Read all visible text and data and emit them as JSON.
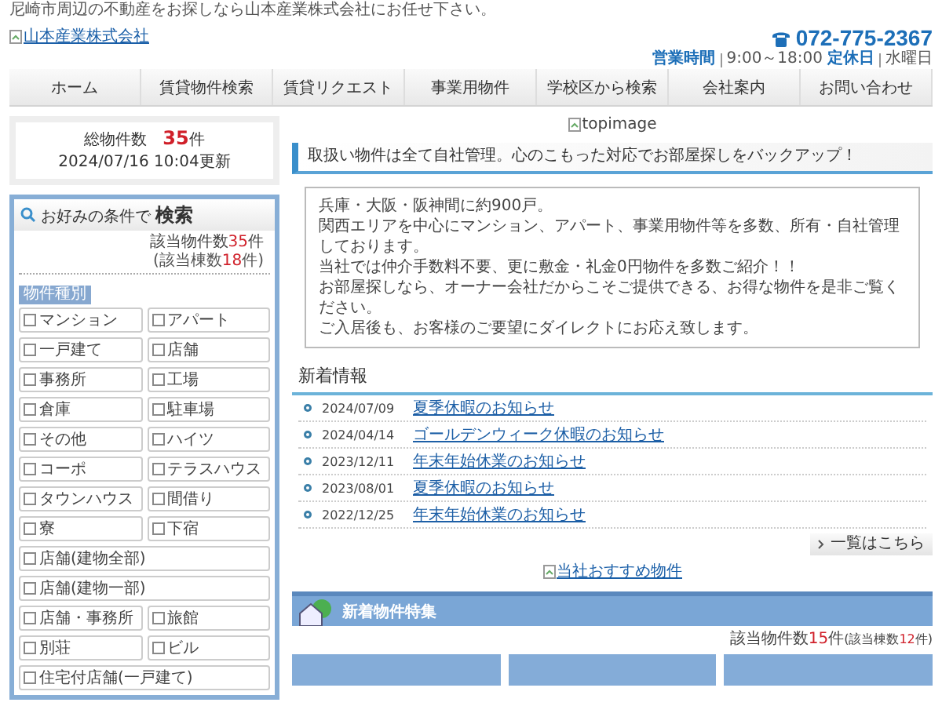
{
  "tagline": "尼崎市周辺の不動産をお探しなら山本産業株式会社にお任せ下さい。",
  "logo": {
    "alt": "山本産業株式会社"
  },
  "phone": {
    "number": "072-775-2367",
    "hours_label": "営業時間",
    "hours": "9:00～18:00",
    "closed_label": "定休日",
    "closed": "水曜日"
  },
  "nav": [
    {
      "label": "ホーム"
    },
    {
      "label": "賃貸物件検索"
    },
    {
      "label": "賃貸リクエスト"
    },
    {
      "label": "事業用物件"
    },
    {
      "label": "学校区から検索"
    },
    {
      "label": "会社案内"
    },
    {
      "label": "お問い合わせ"
    }
  ],
  "summary": {
    "label": "総物件数",
    "count": "35",
    "unit": "件",
    "updated": "2024/07/16 10:04更新"
  },
  "search": {
    "title_prefix": "お好みの条件で",
    "title": "検索",
    "hit_label": "該当物件数",
    "hit_count": "35",
    "hit_unit": "件",
    "sub_prefix": "(該当棟数",
    "sub_count": "18",
    "sub_suffix": "件)",
    "category_label": "物件種別",
    "options": [
      {
        "label": "マンション",
        "kind": "half",
        "checked": false
      },
      {
        "label": "アパート",
        "kind": "half",
        "checked": false
      },
      {
        "label": "一戸建て",
        "kind": "half",
        "checked": false
      },
      {
        "label": "店舗",
        "kind": "half",
        "checked": false
      },
      {
        "label": "事務所",
        "kind": "half",
        "checked": false
      },
      {
        "label": "工場",
        "kind": "half",
        "checked": false
      },
      {
        "label": "倉庫",
        "kind": "half",
        "checked": false
      },
      {
        "label": "駐車場",
        "kind": "half",
        "checked": false
      },
      {
        "label": "その他",
        "kind": "half",
        "checked": false
      },
      {
        "label": "ハイツ",
        "kind": "half",
        "checked": false
      },
      {
        "label": "コーポ",
        "kind": "half",
        "checked": false
      },
      {
        "label": "テラスハウス",
        "kind": "half",
        "checked": false
      },
      {
        "label": "タウンハウス",
        "kind": "half",
        "checked": false
      },
      {
        "label": "間借り",
        "kind": "half",
        "checked": false
      },
      {
        "label": "寮",
        "kind": "half",
        "checked": false
      },
      {
        "label": "下宿",
        "kind": "half",
        "checked": false
      },
      {
        "label": "店舗(建物全部)",
        "kind": "full",
        "checked": false
      },
      {
        "label": "店舗(建物一部)",
        "kind": "full",
        "checked": false
      },
      {
        "label": "店舗・事務所",
        "kind": "half",
        "checked": false
      },
      {
        "label": "旅館",
        "kind": "half",
        "checked": false
      },
      {
        "label": "別荘",
        "kind": "half",
        "checked": false
      },
      {
        "label": "ビル",
        "kind": "half",
        "checked": false
      },
      {
        "label": "住宅付店舗(一戸建て)",
        "kind": "full",
        "checked": false
      }
    ]
  },
  "top_image": {
    "alt": "topimage"
  },
  "headline": "取扱い物件は全て自社管理。心のこもった対応でお部屋探しをバックアップ！",
  "intro": [
    "兵庫・大阪・阪神間に約900戸。",
    "関西エリアを中心にマンション、アパート、事業用物件等を多数、所有・自社管理しております。",
    "当社では仲介手数料不要、更に敷金・礼金0円物件を多数ご紹介！！",
    "お部屋探しなら、オーナー会社だからこそご提供できる、お得な物件を是非ご覧ください。",
    "ご入居後も、お客様のご要望にダイレクトにお応え致します。"
  ],
  "news": {
    "title": "新着情報",
    "items": [
      {
        "date": "2024/07/09",
        "title": "夏季休暇のお知らせ"
      },
      {
        "date": "2024/04/14",
        "title": "ゴールデンウィーク休暇のお知らせ"
      },
      {
        "date": "2023/12/11",
        "title": "年末年始休業のお知らせ"
      },
      {
        "date": "2023/08/01",
        "title": "夏季休暇のお知らせ"
      },
      {
        "date": "2022/12/25",
        "title": "年末年始休業のお知らせ"
      }
    ],
    "more": "一覧はこちら"
  },
  "recommend": {
    "alt": "当社おすすめ物件"
  },
  "feature": {
    "title": "新着物件特集",
    "hit_label": "該当物件数",
    "hit_count": "15",
    "hit_unit": "件",
    "sub_prefix": "(該当棟数",
    "sub_count": "12",
    "sub_suffix": "件)"
  }
}
